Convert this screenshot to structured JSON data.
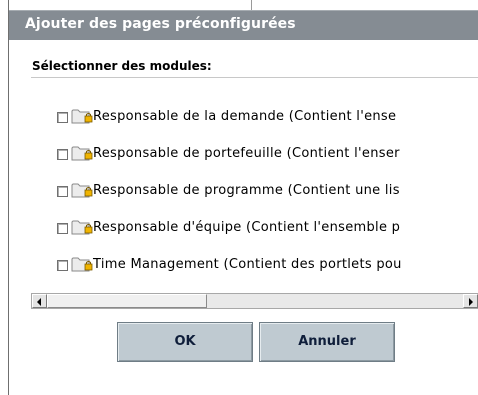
{
  "dialog": {
    "title": "Ajouter des pages préconfigurées",
    "section_label": "Sélectionner des modules:"
  },
  "modules": [
    {
      "label": "Responsable de la demande (Contient l'ense",
      "checked": false,
      "icon": "locked-folder-icon"
    },
    {
      "label": "Responsable de portefeuille (Contient l'enser",
      "checked": false,
      "icon": "locked-folder-icon"
    },
    {
      "label": "Responsable de programme (Contient une lis",
      "checked": false,
      "icon": "locked-folder-icon"
    },
    {
      "label": "Responsable d'équipe (Contient l'ensemble p",
      "checked": false,
      "icon": "locked-folder-icon"
    },
    {
      "label": "Time Management (Contient des portlets pou",
      "checked": false,
      "icon": "locked-folder-icon"
    }
  ],
  "buttons": {
    "ok_label": "OK",
    "cancel_label": "Annuler"
  },
  "colors": {
    "titlebar": "#858c93",
    "button": "#bfcad1",
    "folder": "#e8e8e8",
    "lock": "#f0b400"
  }
}
